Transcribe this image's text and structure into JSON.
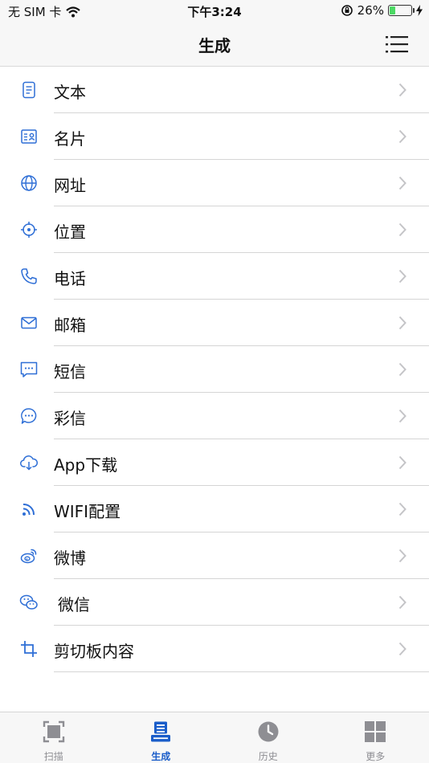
{
  "status_bar": {
    "carrier": "无 SIM 卡",
    "time": "下午3:24",
    "battery_percent": "26%",
    "battery_level": 0.26
  },
  "navbar": {
    "title": "生成"
  },
  "list": [
    {
      "label": "文本",
      "icon": "document-icon"
    },
    {
      "label": "名片",
      "icon": "contact-card-icon"
    },
    {
      "label": "网址",
      "icon": "globe-icon"
    },
    {
      "label": "位置",
      "icon": "crosshair-icon"
    },
    {
      "label": "电话",
      "icon": "phone-icon"
    },
    {
      "label": "邮箱",
      "icon": "mail-icon"
    },
    {
      "label": "短信",
      "icon": "message-icon"
    },
    {
      "label": "彩信",
      "icon": "chat-bubble-icon"
    },
    {
      "label": "App下载",
      "icon": "cloud-download-icon"
    },
    {
      "label": "WIFI配置",
      "icon": "wifi-icon"
    },
    {
      "label": "微博",
      "icon": "weibo-icon"
    },
    {
      "label": "微信",
      "icon": "wechat-icon"
    },
    {
      "label": "剪切板内容",
      "icon": "crop-icon"
    }
  ],
  "tabbar": {
    "tabs": [
      {
        "label": "扫描",
        "icon": "scan-icon",
        "active": false
      },
      {
        "label": "生成",
        "icon": "generate-icon",
        "active": true
      },
      {
        "label": "历史",
        "icon": "clock-icon",
        "active": false
      },
      {
        "label": "更多",
        "icon": "grid-icon",
        "active": false
      }
    ]
  },
  "colors": {
    "accent": "#1a5dc9",
    "icon_blue": "#2f6fd6",
    "inactive": "#8e8e93"
  }
}
